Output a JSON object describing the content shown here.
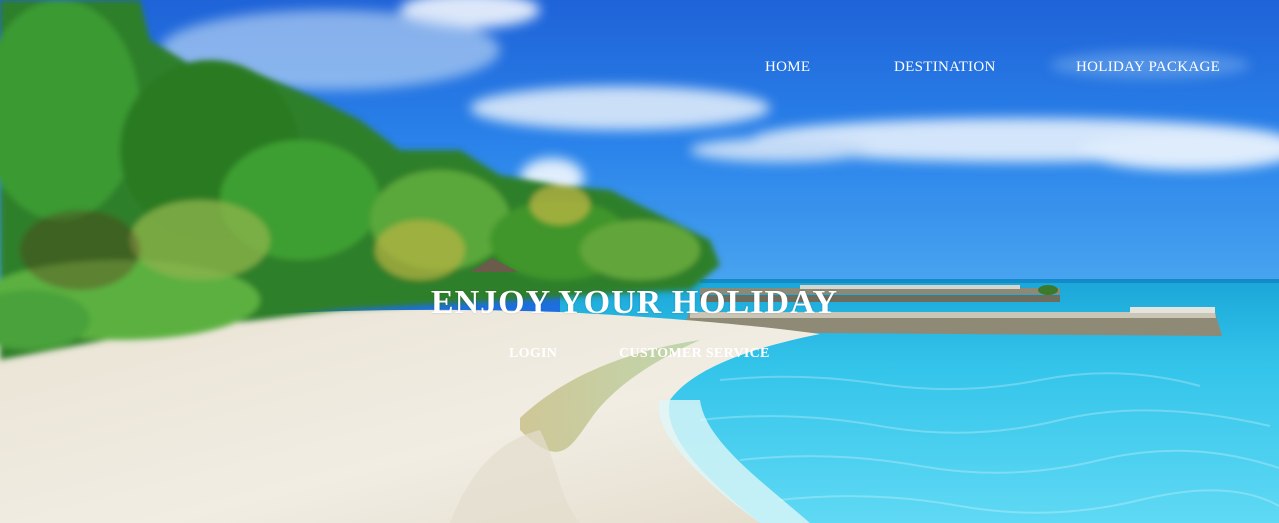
{
  "nav": {
    "items": [
      {
        "label": "HOME"
      },
      {
        "label": "DESTINATION"
      },
      {
        "label": "HOLIDAY PACKAGE"
      }
    ]
  },
  "hero": {
    "title": "ENJOY YOUR HOLIDAY",
    "background": "tropical-beach-photo",
    "actions": [
      {
        "label": "LOGIN"
      },
      {
        "label": "CUSTOMER SERVICE"
      }
    ]
  },
  "colors": {
    "text": "#ffffff",
    "sky": "#1d6fe0",
    "sea": "#3fc6ea",
    "sand": "#eeeae0",
    "foliage": "#2f8a2a"
  }
}
